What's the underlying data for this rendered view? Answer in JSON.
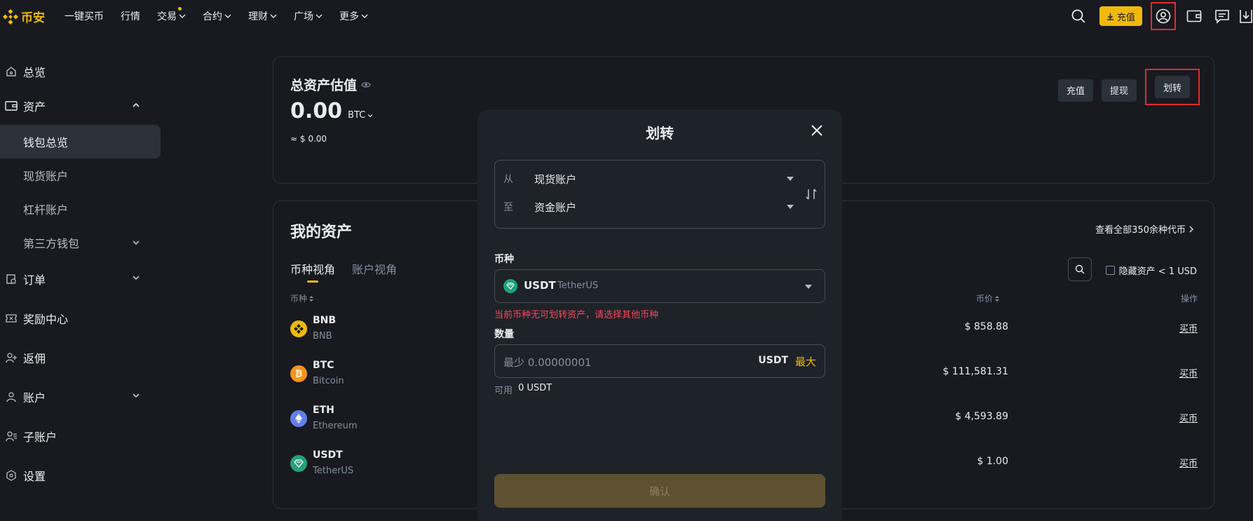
{
  "brand": {
    "name": "币安",
    "accent": "#f0b90b"
  },
  "nav": {
    "items": [
      {
        "label": "一键买币",
        "dropdown": false
      },
      {
        "label": "行情",
        "dropdown": false
      },
      {
        "label": "交易",
        "dropdown": true,
        "dot": true
      },
      {
        "label": "合约",
        "dropdown": true
      },
      {
        "label": "理财",
        "dropdown": true
      },
      {
        "label": "广场",
        "dropdown": true
      },
      {
        "label": "更多",
        "dropdown": true
      }
    ],
    "deposit_label": "充值"
  },
  "sidebar": {
    "overview": "总览",
    "assets": "资产",
    "wallet_overview": "钱包总览",
    "spot_account": "现货账户",
    "margin_account": "杠杆账户",
    "third_party_wallet": "第三方钱包",
    "orders": "订单",
    "rewards": "奖励中心",
    "referral": "返佣",
    "account": "账户",
    "sub_account": "子账户",
    "settings": "设置"
  },
  "summary": {
    "title": "总资产估值",
    "value": "0.00",
    "unit": "BTC",
    "usd_value": "≈ $ 0.00",
    "deposit": "充值",
    "withdraw": "提现",
    "transfer": "划转"
  },
  "assets": {
    "title": "我的资产",
    "view_all": "查看全部350余种代币",
    "tab_coin": "币种视角",
    "tab_account": "账户视角",
    "hide_small": "隐藏资产 < 1 USD",
    "col_coin": "币种",
    "col_price": "币价",
    "col_action": "操作",
    "rows": [
      {
        "symbol": "BNB",
        "name": "BNB",
        "price": "$ 858.88",
        "action": "买币",
        "color": "#f0b90b"
      },
      {
        "symbol": "BTC",
        "name": "Bitcoin",
        "price": "$ 111,581.31",
        "action": "买币",
        "color": "#f7931a"
      },
      {
        "symbol": "ETH",
        "name": "Ethereum",
        "price": "$ 4,593.89",
        "action": "买币",
        "color": "#627eea"
      },
      {
        "symbol": "USDT",
        "name": "TetherUS",
        "price": "$ 1.00",
        "action": "买币",
        "color": "#26a17b"
      }
    ]
  },
  "modal": {
    "title": "划转",
    "from_label": "从",
    "from_value": "现货账户",
    "to_label": "至",
    "to_value": "资金账户",
    "coin_label": "币种",
    "coin_symbol": "USDT",
    "coin_name": "TetherUS",
    "error": "当前币种无可划转资产，请选择其他币种",
    "amount_label": "数量",
    "amount_placeholder": "最少 0.00000001",
    "amount_unit": "USDT",
    "max": "最大",
    "available_label": "可用",
    "available_value": "0 USDT",
    "confirm": "确认"
  }
}
